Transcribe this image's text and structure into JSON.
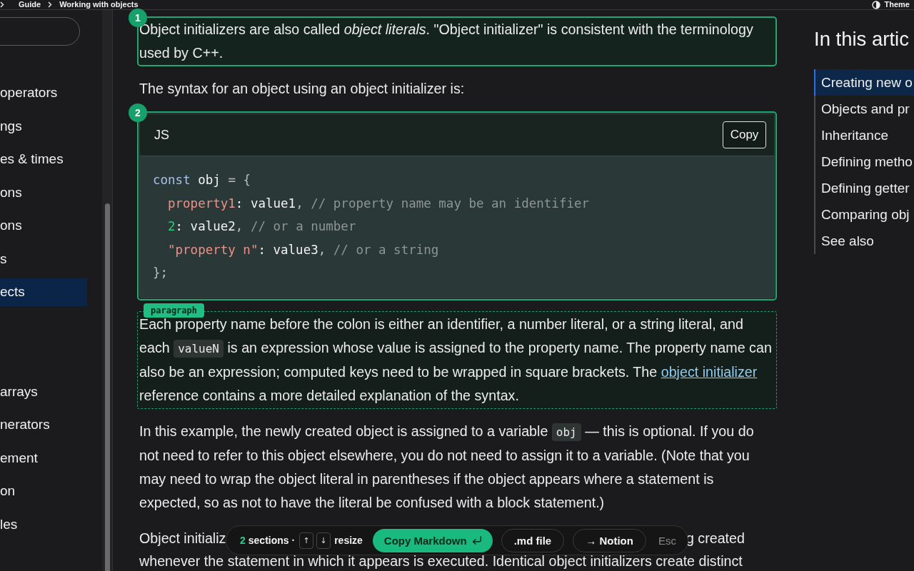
{
  "header": {
    "breadcrumbs": [
      "Guide",
      "Working with objects"
    ],
    "theme_button": "Theme"
  },
  "sidebar": {
    "groups": [
      {
        "items": [
          {
            "label": "operators",
            "selected": false
          },
          {
            "label": "ngs",
            "selected": false
          },
          {
            "label": "es & times",
            "selected": false
          },
          {
            "label": "ons",
            "selected": false
          },
          {
            "label": "ons",
            "selected": false
          },
          {
            "label": "s",
            "selected": false
          },
          {
            "label": "ects",
            "selected": true
          }
        ]
      },
      {
        "items": [
          {
            "label": "arrays",
            "selected": false
          },
          {
            "label": "nerators",
            "selected": false
          },
          {
            "label": "ement",
            "selected": false
          },
          {
            "label": "on",
            "selected": false
          },
          {
            "label": "les",
            "selected": false
          }
        ]
      }
    ]
  },
  "article": {
    "blocks": [
      {
        "kind": "callout",
        "badge": "1",
        "text": "Object initializers are also called *object literals*. \"Object initializer\" is consistent with the terminology used by C++."
      },
      {
        "kind": "paragraph",
        "segments": [
          {
            "kind": "text",
            "text": "The syntax for an object using an object initializer is:"
          }
        ]
      },
      {
        "kind": "code",
        "badge": "2",
        "language": "JS",
        "copy_button": "Copy",
        "lines": [
          {
            "indented": false,
            "tokens": [
              {
                "kind": "keyword",
                "text": "const"
              },
              {
                "kind": "plain",
                "text": " obj "
              },
              {
                "kind": "punct",
                "text": "= {"
              }
            ]
          },
          {
            "indented": true,
            "tokens": [
              {
                "kind": "property",
                "text": "property1"
              },
              {
                "kind": "plain",
                "text": ": value1"
              },
              {
                "kind": "punct",
                "text": ","
              },
              {
                "kind": "comment",
                "text": " // property name may be an identifier"
              }
            ]
          },
          {
            "indented": true,
            "tokens": [
              {
                "kind": "number",
                "text": "2"
              },
              {
                "kind": "plain",
                "text": ": value2"
              },
              {
                "kind": "punct",
                "text": ","
              },
              {
                "kind": "comment",
                "text": " // or a number"
              }
            ]
          },
          {
            "indented": true,
            "tokens": [
              {
                "kind": "string",
                "text": "\"property n\""
              },
              {
                "kind": "plain",
                "text": ": value3"
              },
              {
                "kind": "punct",
                "text": ","
              },
              {
                "kind": "comment",
                "text": " // or a string"
              }
            ]
          },
          {
            "indented": false,
            "tokens": [
              {
                "kind": "punct",
                "text": "};"
              }
            ]
          }
        ]
      },
      {
        "kind": "tagged",
        "tag": "paragraph",
        "segments": [
          {
            "kind": "text",
            "text": "Each property name before the colon is either an identifier, a number literal, or a string literal, and each "
          },
          {
            "kind": "code",
            "text": "valueN"
          },
          {
            "kind": "text",
            "text": " is an expression whose value is assigned to the property name. The property name can also be an expression; computed keys need to be wrapped in square brackets. The "
          },
          {
            "kind": "link",
            "text": "object initializer"
          },
          {
            "kind": "text",
            "text": " reference contains a more detailed explanation of the syntax."
          }
        ]
      },
      {
        "kind": "paragraph",
        "segments": [
          {
            "kind": "text",
            "text": "In this example, the newly created object is assigned to a variable "
          },
          {
            "kind": "code",
            "text": "obj"
          },
          {
            "kind": "text",
            "text": " — this is optional. If you do not need to refer to this object elsewhere, you do not need to assign it to a variable. (Note that you may need to wrap the object literal in parentheses if the object appears where a statement is expected, so as not to have the literal be confused with a block statement.)"
          }
        ]
      },
      {
        "kind": "covered",
        "fragments": [
          "Object initializ",
          "g created"
        ],
        "next_line": "whenever the statement in which it appears is executed. Identical object initializers create distinct"
      }
    ]
  },
  "toc": {
    "title": "In this artic",
    "items": [
      {
        "label": "Creating new o",
        "selected": true
      },
      {
        "label": "Objects and pr",
        "selected": false
      },
      {
        "label": "Inheritance",
        "selected": false
      },
      {
        "label": "Defining metho",
        "selected": false
      },
      {
        "label": "Defining getter",
        "selected": false
      },
      {
        "label": "Comparing obj",
        "selected": false
      },
      {
        "label": "See also",
        "selected": false
      }
    ]
  },
  "export_bar": {
    "count": "2",
    "label": "sections ·",
    "keys": [
      "↑",
      "↓"
    ],
    "keys_label": "resize",
    "buttons": [
      {
        "kind": "primary",
        "label": "Copy Markdown"
      },
      {
        "kind": "outline",
        "label": ".md file"
      },
      {
        "kind": "outline",
        "label": "→ Notion"
      },
      {
        "kind": "plain",
        "label": "Esc"
      }
    ]
  }
}
